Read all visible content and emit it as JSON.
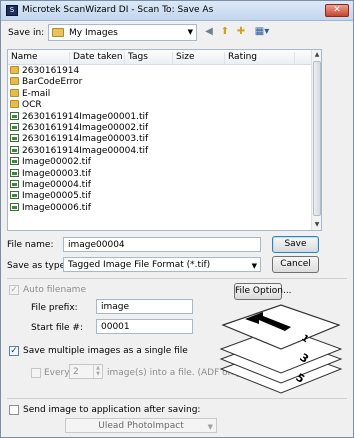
{
  "window": {
    "app_icon": "scanner-icon",
    "title": "Microtek ScanWizard DI - Scan To: Save As",
    "close_label": "✕"
  },
  "toolbar": {
    "save_in_label": "Save in:",
    "save_in_value": "My Images",
    "icons": [
      "back-arrow-icon",
      "up-folder-icon",
      "new-folder-icon",
      "view-menu-icon"
    ]
  },
  "file_list": {
    "columns": [
      "Name",
      "Date taken",
      "Tags",
      "Size",
      "Rating"
    ],
    "items": [
      {
        "type": "folder",
        "name": "2630161914"
      },
      {
        "type": "folder",
        "name": "BarCodeError"
      },
      {
        "type": "folder",
        "name": "E-mail"
      },
      {
        "type": "folder",
        "name": "OCR"
      },
      {
        "type": "file",
        "name": "2630161914Image00001.tif"
      },
      {
        "type": "file",
        "name": "2630161914Image00002.tif"
      },
      {
        "type": "file",
        "name": "2630161914Image00003.tif"
      },
      {
        "type": "file",
        "name": "2630161914Image00004.tif"
      },
      {
        "type": "file",
        "name": "Image00002.tif"
      },
      {
        "type": "file",
        "name": "Image00003.tif"
      },
      {
        "type": "file",
        "name": "Image00004.tif"
      },
      {
        "type": "file",
        "name": "Image00005.tif"
      },
      {
        "type": "file",
        "name": "Image00006.tif"
      }
    ]
  },
  "form": {
    "file_name_label": "File name:",
    "file_name_value": "image00004",
    "save_as_type_label": "Save as type:",
    "save_as_type_value": "Tagged Image File Format (*.tif)",
    "save_button": "Save",
    "cancel_button": "Cancel"
  },
  "options": {
    "auto_filename_label": "Auto filename",
    "file_option_button": "File Option...",
    "file_prefix_label": "File prefix:",
    "file_prefix_value": "image",
    "start_file_label": "Start file #:",
    "start_file_value": "00001",
    "save_multiple_label": "Save multiple images as a single file",
    "every_label": "Every",
    "every_value": "2",
    "every_suffix": "image(s) into a file. (ADF only)",
    "send_to_app_label": "Send image to application after saving:",
    "app_value": "Ulead PhotoImpact"
  },
  "colors": {
    "title_gradient": "#c3d6ee",
    "close_red": "#c9442f",
    "default_button_border": "#3c7fb1"
  }
}
